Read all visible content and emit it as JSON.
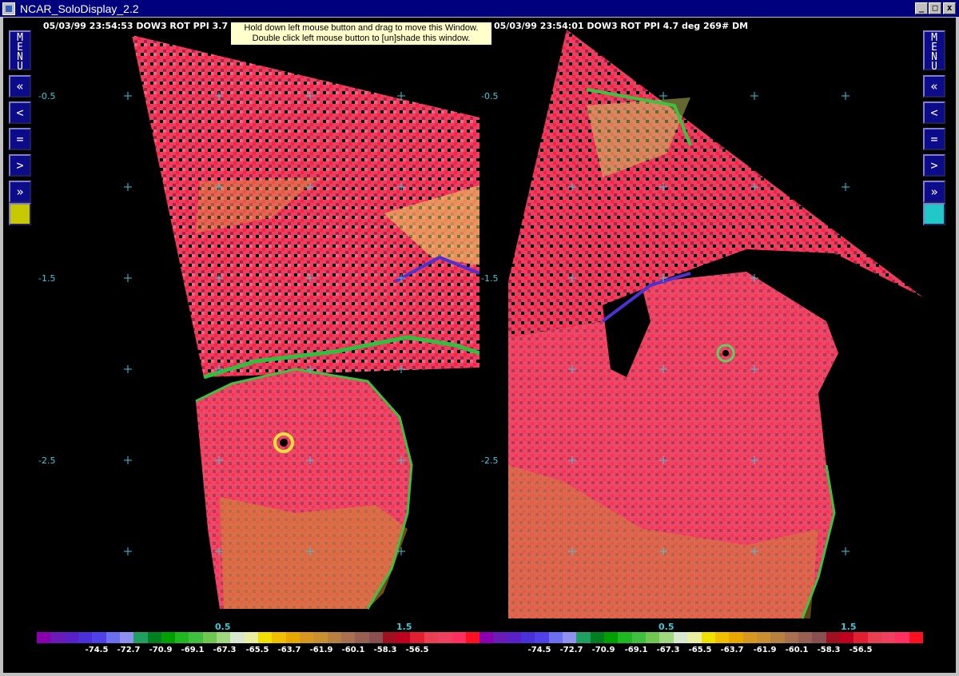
{
  "window": {
    "title": "NCAR_SoloDisplay_2.2",
    "minimize_label": "_",
    "maximize_label": "□",
    "close_label": "x"
  },
  "sidebar": {
    "menu_label": "MENU",
    "buttons": [
      "«",
      "<",
      "=",
      ">",
      "»"
    ],
    "left_swatch_color": "#c8c800",
    "right_swatch_color": "#20c8c8"
  },
  "tooltip": {
    "line1": "Hold down left mouse button and drag to move this Window.",
    "line2": "Double click left mouse button to [un]shade this window."
  },
  "panels": [
    {
      "header": "05/03/99 23:54:53  DOW3  ROT PPI    3.7",
      "y_labels": [
        "-0.5",
        "-1.5",
        "-2.5"
      ],
      "x_labels": [
        "0.5",
        "1.5"
      ]
    },
    {
      "header": "05/03/99 23:54:01  DOW3  ROT PPI    4.7 deg 269#  DM",
      "y_labels": [
        "-0.5",
        "-1.5",
        "-2.5"
      ],
      "x_labels": [
        "0.5",
        "1.5"
      ]
    }
  ],
  "colorbar": {
    "labels": [
      "-74.5",
      "-72.7",
      "-70.9",
      "-69.1",
      "-67.3",
      "-65.5",
      "-63.7",
      "-61.9",
      "-60.1",
      "-58.3",
      "-56.5"
    ],
    "colors": [
      "#8a00b0",
      "#6a1ab8",
      "#5a20c8",
      "#4a30d8",
      "#5040e8",
      "#6a70f0",
      "#9090f0",
      "#20a060",
      "#008020",
      "#00a000",
      "#20b820",
      "#40c040",
      "#70c850",
      "#a0d880",
      "#d8e8d0",
      "#e8f0a0",
      "#f0e000",
      "#f0c000",
      "#e8a800",
      "#d89820",
      "#c89030",
      "#b88040",
      "#a87050",
      "#986050",
      "#885050",
      "#a01020",
      "#c00020",
      "#e02030",
      "#e84050",
      "#f04060",
      "#ff3060",
      "#ff1020"
    ]
  }
}
